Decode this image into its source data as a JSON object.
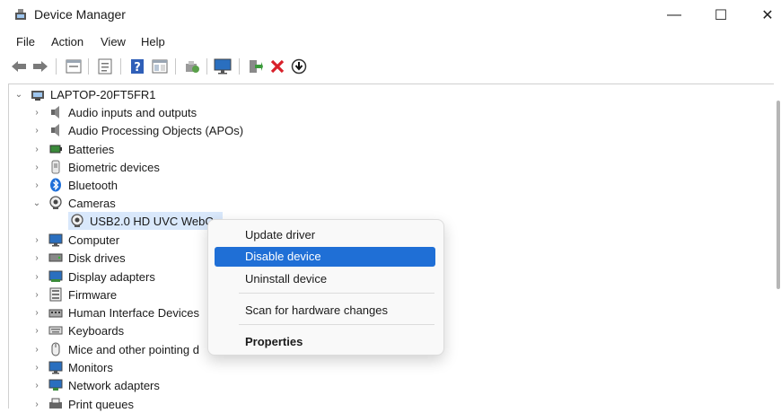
{
  "window": {
    "title": "Device Manager",
    "icon": "device-manager-icon"
  },
  "window_buttons": {
    "minimize": "—",
    "maximize": "☐",
    "close": "✕"
  },
  "menu": [
    "File",
    "Action",
    "View",
    "Help"
  ],
  "toolbar": {
    "icons": [
      "back-icon",
      "forward-icon",
      "properties-sheet-icon",
      "properties-icon",
      "help-icon",
      "view-icon",
      "scan-icon",
      "monitor-icon",
      "update-driver-icon",
      "uninstall-icon",
      "disable-icon"
    ]
  },
  "tree": {
    "root": "LAPTOP-20FT5FR1",
    "items": [
      {
        "label": "Audio inputs and outputs",
        "expanded": false
      },
      {
        "label": "Audio Processing Objects (APOs)",
        "expanded": false
      },
      {
        "label": "Batteries",
        "expanded": false
      },
      {
        "label": "Biometric devices",
        "expanded": false
      },
      {
        "label": "Bluetooth",
        "expanded": false
      },
      {
        "label": "Cameras",
        "expanded": true
      },
      {
        "label": "USB2.0 HD UVC WebCa",
        "child": true,
        "selected": true
      },
      {
        "label": "Computer",
        "expanded": false
      },
      {
        "label": "Disk drives",
        "expanded": false
      },
      {
        "label": "Display adapters",
        "expanded": false
      },
      {
        "label": "Firmware",
        "expanded": false
      },
      {
        "label": "Human Interface Devices",
        "expanded": false
      },
      {
        "label": "Keyboards",
        "expanded": false
      },
      {
        "label": "Mice and other pointing d",
        "expanded": false
      },
      {
        "label": "Monitors",
        "expanded": false
      },
      {
        "label": "Network adapters",
        "expanded": false
      },
      {
        "label": "Print queues",
        "expanded": false
      }
    ]
  },
  "context_menu": {
    "update": "Update driver",
    "disable": "Disable device",
    "uninstall": "Uninstall device",
    "scan": "Scan for hardware changes",
    "properties": "Properties"
  },
  "colors": {
    "highlight": "#1f6fd6",
    "selection": "#d9e8fb"
  }
}
